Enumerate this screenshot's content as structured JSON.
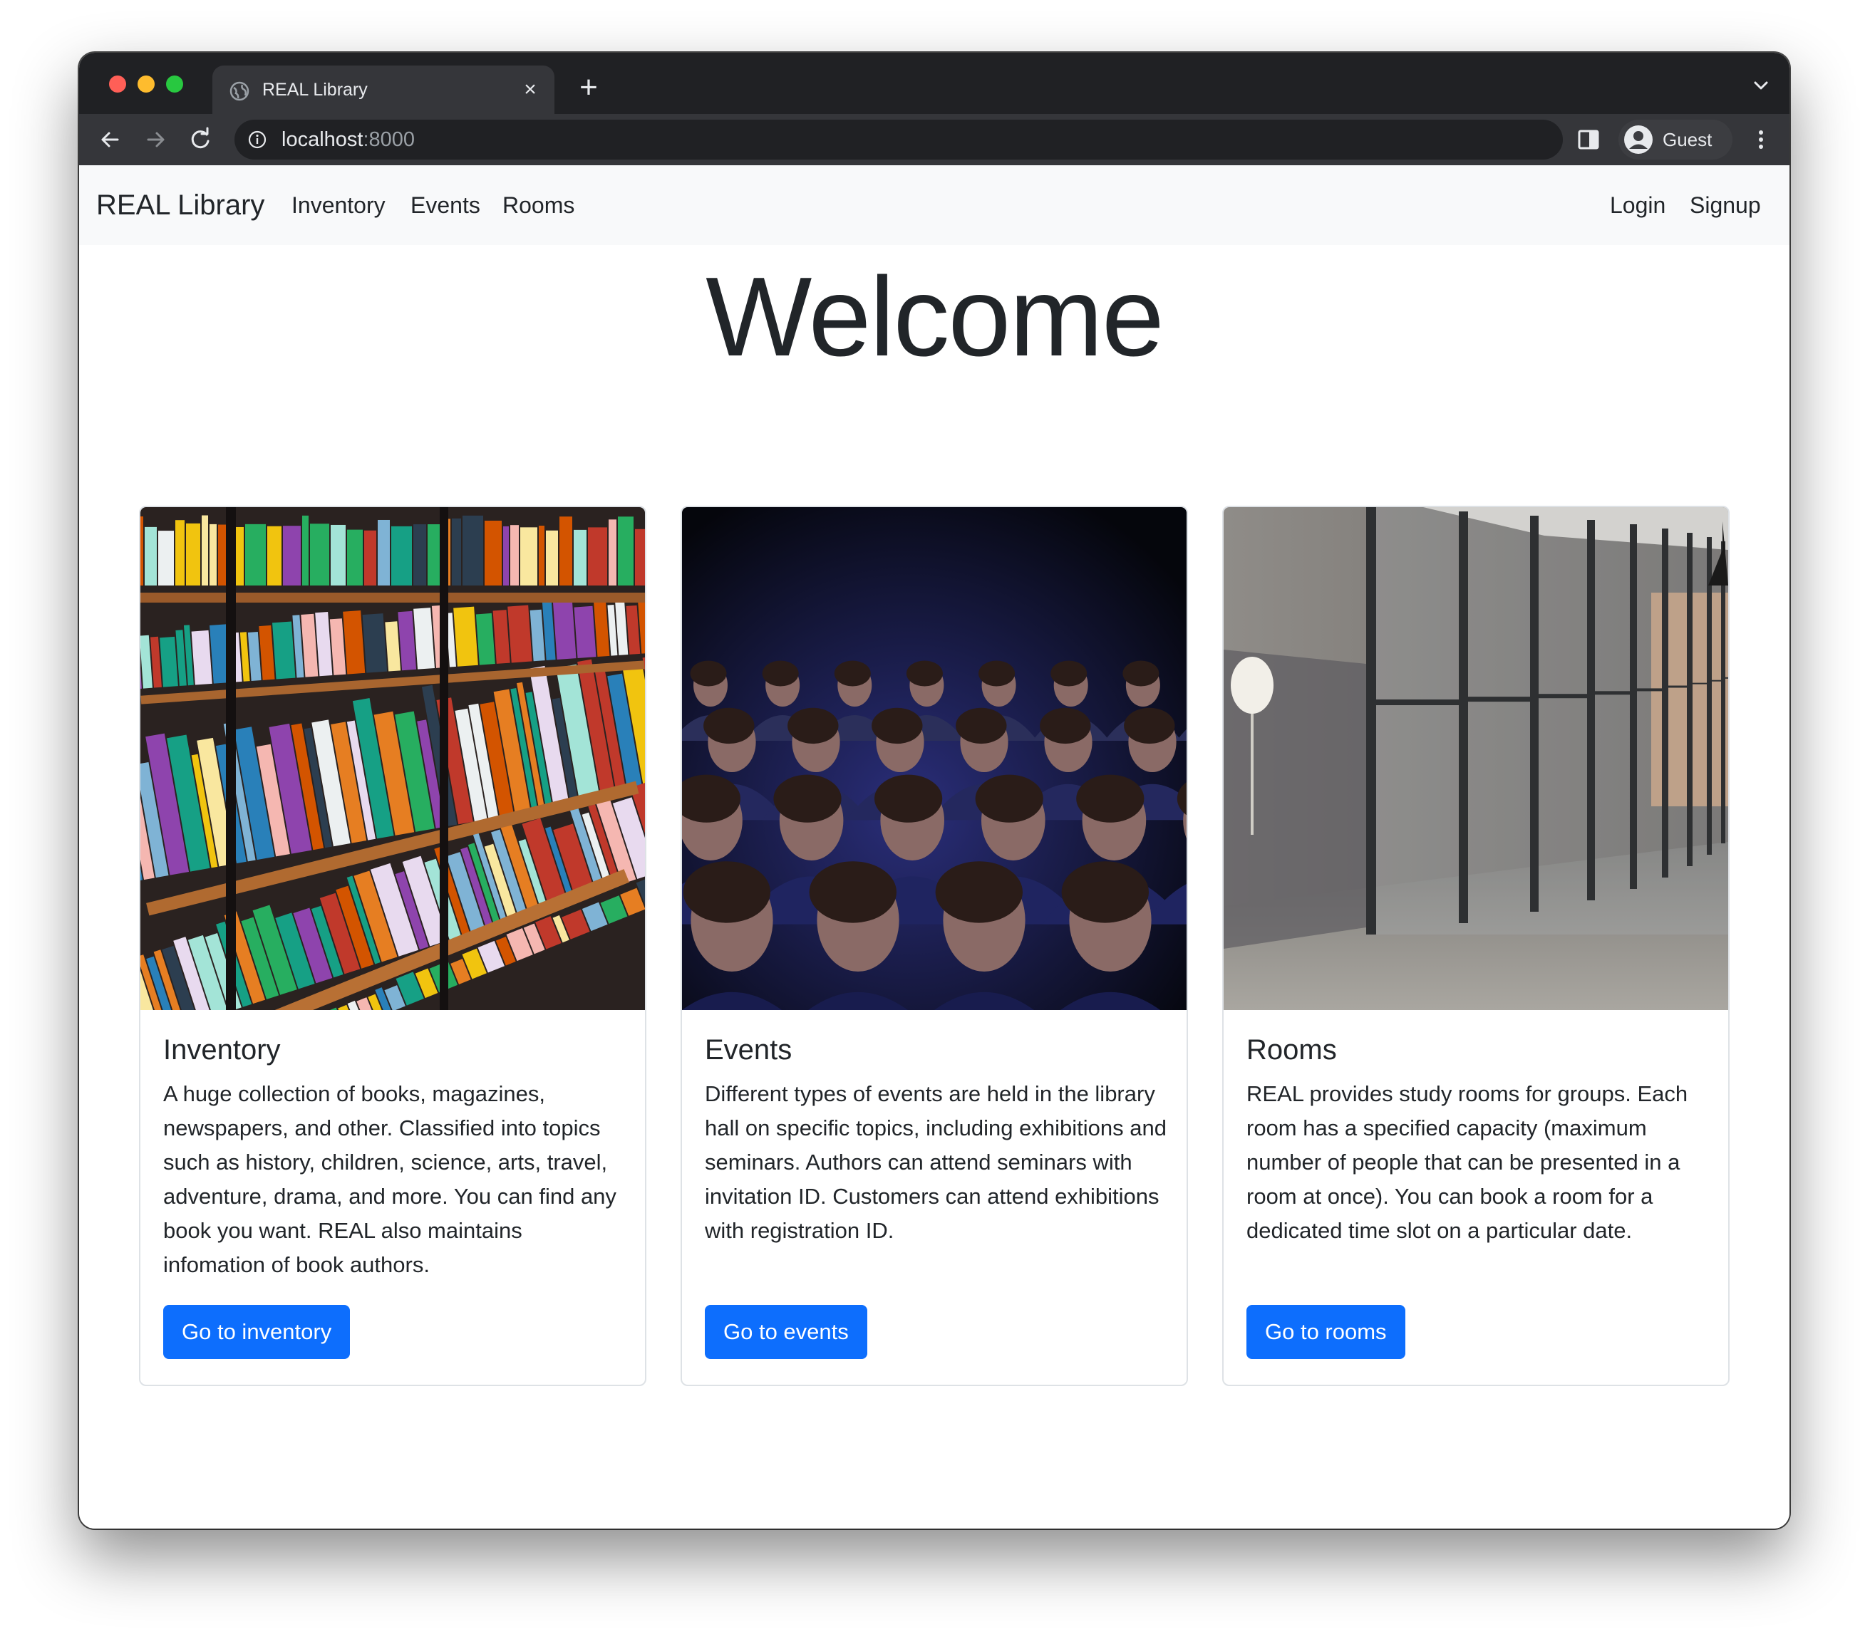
{
  "browser": {
    "tab_title": "REAL Library",
    "tab_close": "×",
    "new_tab": "+",
    "url_host": "localhost",
    "url_port": ":8000",
    "profile_label": "Guest"
  },
  "navbar": {
    "brand": "REAL Library",
    "links": [
      "Inventory",
      "Events",
      "Rooms"
    ],
    "auth": [
      "Login",
      "Signup"
    ]
  },
  "hero": {
    "title": "Welcome"
  },
  "cards": [
    {
      "title": "Inventory",
      "text": "A huge collection of books, magazines, newspapers, and other. Classified into topics such as history, children, science, arts, travel, adventure, drama, and more. You can find any book you want. REAL also maintains infomation of book authors.",
      "button": "Go to inventory",
      "image": "bookshelf-photo"
    },
    {
      "title": "Events",
      "text": "Different types of events are held in the library hall on specific topics, including exhibitions and seminars. Authors can attend seminars with invitation ID. Customers can attend exhibitions with registration ID.",
      "button": "Go to events",
      "image": "audience-photo"
    },
    {
      "title": "Rooms",
      "text": "REAL provides study rooms for groups. Each room has a specified capacity (maximum number of people that can be presented in a room at once). You can book a room for a dedicated time slot on a particular date.",
      "button": "Go to rooms",
      "image": "glass-rooms-corridor-photo"
    }
  ],
  "colors": {
    "primary": "#0d6efd",
    "navbar_bg": "#f8f9fa",
    "chrome_dark": "#202124"
  }
}
